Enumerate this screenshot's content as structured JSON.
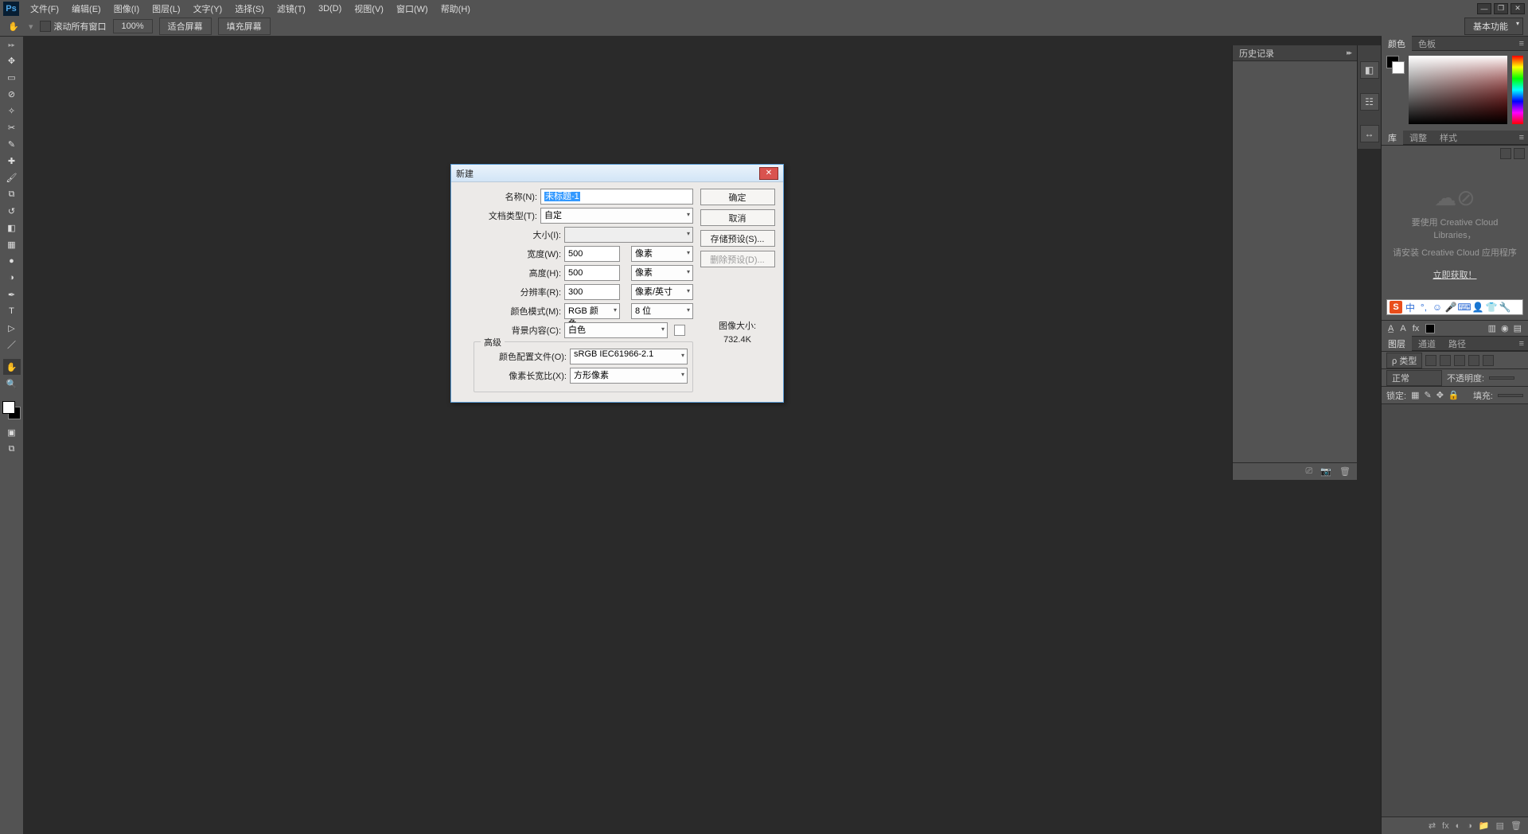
{
  "app": {
    "logo": "Ps"
  },
  "menu": [
    "文件(F)",
    "编辑(E)",
    "图像(I)",
    "图层(L)",
    "文字(Y)",
    "选择(S)",
    "滤镜(T)",
    "3D(D)",
    "视图(V)",
    "窗口(W)",
    "帮助(H)"
  ],
  "optionsbar": {
    "scroll_all": "滚动所有窗口",
    "zoom": "100%",
    "fit_screen": "适合屏幕",
    "fill_screen": "填充屏幕",
    "basic_fn": "基本功能"
  },
  "history_panel": {
    "title": "历史记录"
  },
  "color_panel": {
    "tab_color": "颜色",
    "tab_swatch": "色板"
  },
  "lib_panel": {
    "tab_lib": "库",
    "tab_adjust": "调整",
    "tab_style": "样式",
    "msg1": "要使用 Creative Cloud Libraries，",
    "msg2": "请安装 Creative Cloud 应用程序",
    "link": "立即获取！",
    "ime_label": "中"
  },
  "layers_panel": {
    "tab_layers": "图层",
    "tab_channels": "通道",
    "tab_paths": "路径",
    "kind_label": "ρ 类型",
    "blend_mode": "正常",
    "opacity_label": "不透明度:",
    "lock_label": "锁定:",
    "fill_label": "填充:"
  },
  "dialog": {
    "title": "新建",
    "name_label": "名称(N):",
    "name_value": "未标题-1",
    "doctype_label": "文档类型(T):",
    "doctype_value": "自定",
    "size_label": "大小(I):",
    "size_value": "",
    "width_label": "宽度(W):",
    "width_value": "500",
    "width_unit": "像素",
    "height_label": "高度(H):",
    "height_value": "500",
    "height_unit": "像素",
    "res_label": "分辨率(R):",
    "res_value": "300",
    "res_unit": "像素/英寸",
    "mode_label": "颜色模式(M):",
    "mode_value": "RGB 颜色",
    "depth_value": "8 位",
    "bg_label": "背景内容(C):",
    "bg_value": "白色",
    "advanced": "高级",
    "profile_label": "颜色配置文件(O):",
    "profile_value": "sRGB IEC61966-2.1",
    "aspect_label": "像素长宽比(X):",
    "aspect_value": "方形像素",
    "ok": "确定",
    "cancel": "取消",
    "save_preset": "存储预设(S)...",
    "delete_preset": "删除预设(D)...",
    "imgsize_label": "图像大小:",
    "imgsize_value": "732.4K"
  }
}
